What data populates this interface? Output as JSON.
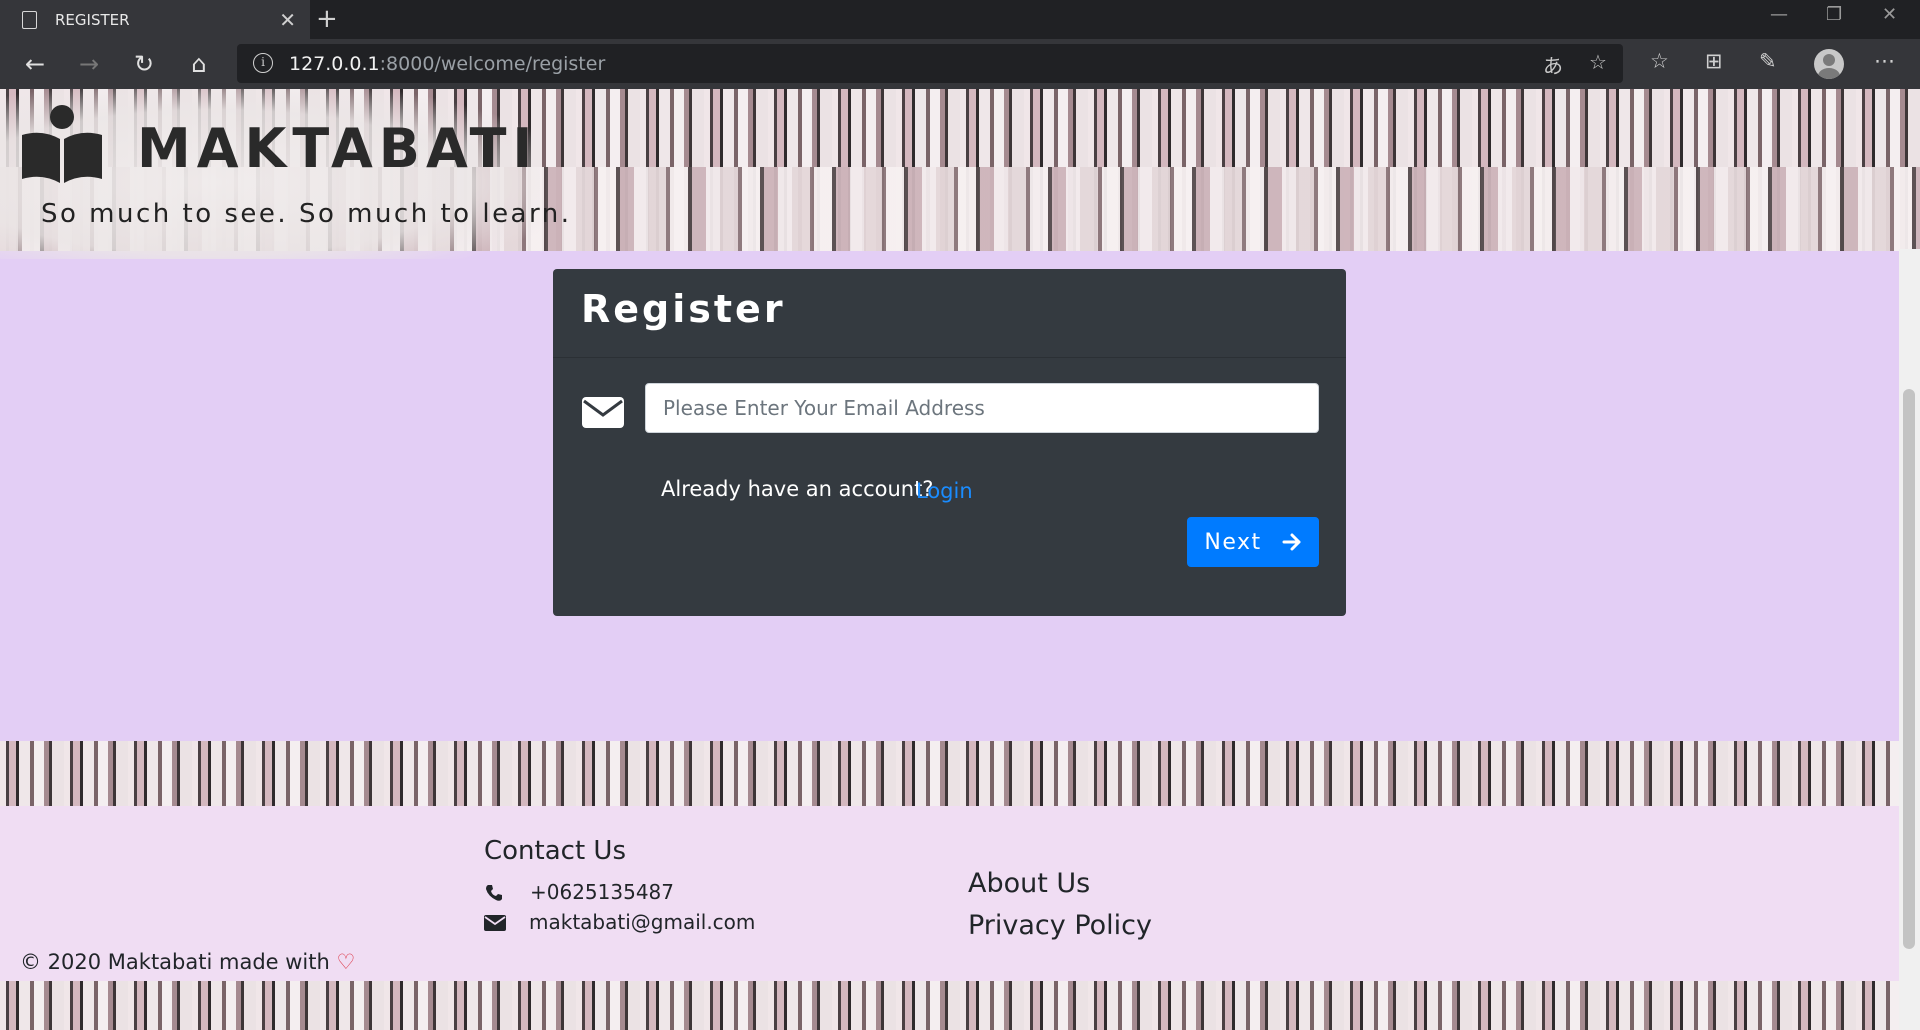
{
  "browser": {
    "tab_title": "REGISTER",
    "url_host": "127.0.0.1",
    "url_rest": ":8000/welcome/register"
  },
  "brand": {
    "name": "MAKTABATI",
    "tagline": "So much to see. So much to learn."
  },
  "register": {
    "title": "Register",
    "email_placeholder": "Please Enter Your Email Address",
    "email_value": "",
    "already_text": "Already have an account?",
    "login_label": "Login",
    "next_label": "Next"
  },
  "footer": {
    "contact_title": "Contact Us",
    "phone": "+0625135487",
    "email": "maktabati@gmail.com",
    "about_label": "About Us",
    "privacy_label": "Privacy Policy",
    "copyright": "© 2020 Maktabati made with",
    "heart": "♡"
  },
  "colors": {
    "page_bg": "#e3cef5",
    "card_bg": "#343a40",
    "primary": "#007bff",
    "link": "#1a8cff",
    "footer_bg": "#f0ddf3",
    "heart": "#dc3545"
  },
  "icons": [
    "page-icon",
    "back-icon",
    "forward-icon",
    "refresh-icon",
    "home-icon",
    "info-icon",
    "translate-icon",
    "star-icon",
    "favorites-icon",
    "collections-icon",
    "feedback-icon",
    "profile-icon",
    "more-icon",
    "envelope-icon",
    "arrow-right-icon",
    "phone-icon",
    "heart-icon"
  ]
}
